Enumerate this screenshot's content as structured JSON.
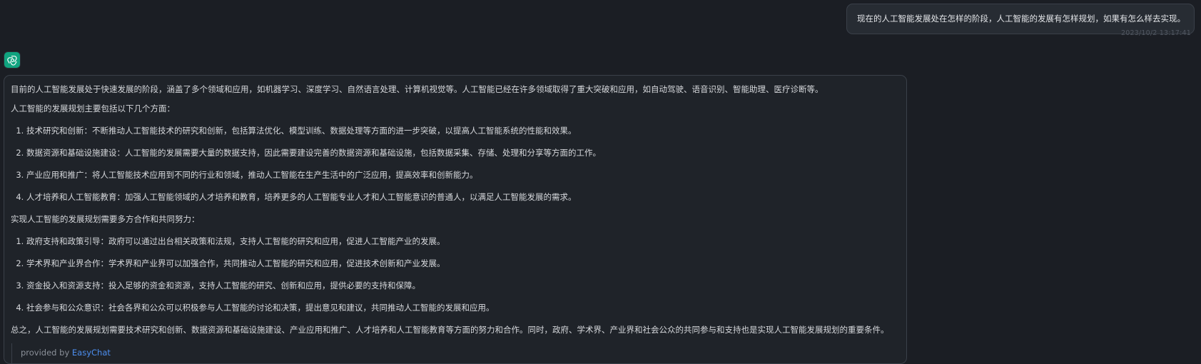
{
  "user_message": {
    "text": "现在的人工智能发展处在怎样的阶段，人工智能的发展有怎样规划，如果有怎么样去实现。",
    "timestamp": "2023/10/2 13:17:41"
  },
  "assistant": {
    "avatar_icon": "openai-logo-icon",
    "accent_color": "#10a37f",
    "intro": "目前的人工智能发展处于快速发展的阶段，涵盖了多个领域和应用，如机器学习、深度学习、自然语言处理、计算机视觉等。人工智能已经在许多领域取得了重大突破和应用，如自动驾驶、语音识别、智能助理、医疗诊断等。",
    "plan_heading": "人工智能的发展规划主要包括以下几个方面：",
    "plan_items": [
      "技术研究和创新：不断推动人工智能技术的研究和创新，包括算法优化、模型训练、数据处理等方面的进一步突破，以提高人工智能系统的性能和效果。",
      "数据资源和基础设施建设：人工智能的发展需要大量的数据支持，因此需要建设完善的数据资源和基础设施，包括数据采集、存储、处理和分享等方面的工作。",
      "产业应用和推广：将人工智能技术应用到不同的行业和领域，推动人工智能在生产生活中的广泛应用，提高效率和创新能力。",
      "人才培养和人工智能教育：加强人工智能领域的人才培养和教育，培养更多的人工智能专业人才和人工智能意识的普通人，以满足人工智能发展的需求。"
    ],
    "realize_heading": "实现人工智能的发展规划需要多方合作和共同努力：",
    "realize_items": [
      "政府支持和政策引导：政府可以通过出台相关政策和法规，支持人工智能的研究和应用，促进人工智能产业的发展。",
      "学术界和产业界合作：学术界和产业界可以加强合作，共同推动人工智能的研究和应用，促进技术创新和产业发展。",
      "资金投入和资源支持：投入足够的资金和资源，支持人工智能的研究、创新和应用，提供必要的支持和保障。",
      "社会参与和公众意识：社会各界和公众可以积极参与人工智能的讨论和决策，提出意见和建议，共同推动人工智能的发展和应用。"
    ],
    "summary": "总之，人工智能的发展规划需要技术研究和创新、数据资源和基础设施建设、产业应用和推广、人才培养和人工智能教育等方面的努力和合作。同时，政府、学术界、产业界和社会公众的共同参与和支持也是实现人工智能发展规划的重要条件。",
    "provider_prefix": "provided by",
    "provider_name": "EasyChat",
    "provider_color": "#4d8ff0"
  }
}
